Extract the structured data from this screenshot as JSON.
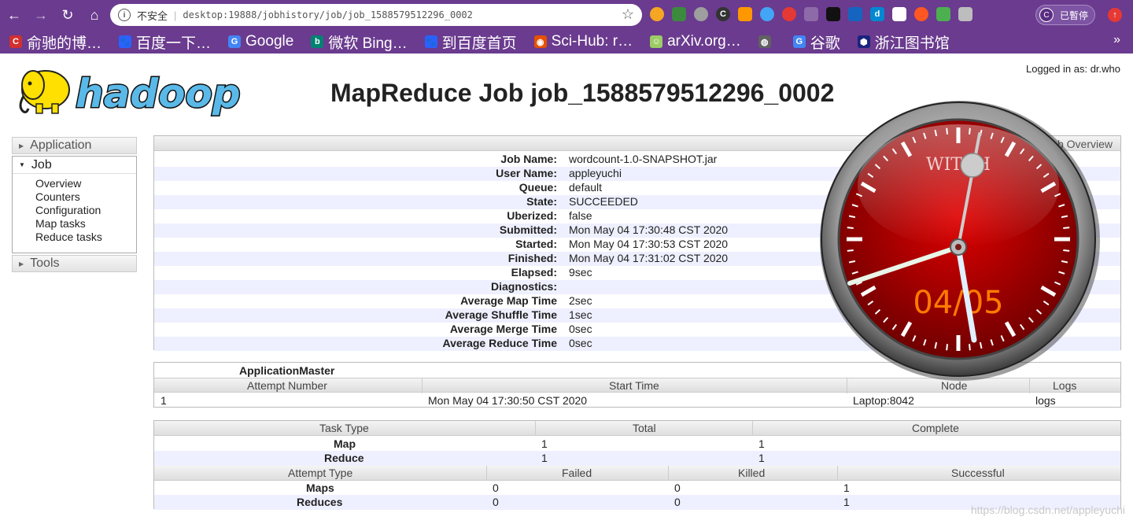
{
  "browser": {
    "insecure_label": "不安全",
    "url": "desktop:19888/jobhistory/job/job_1588579512296_0002",
    "profile_initial": "C",
    "profile_label": "已暫停",
    "bookmarks": [
      {
        "label": "俞驰的博…",
        "fav_color": "#d32f2f",
        "fav_char": "C"
      },
      {
        "label": "百度一下…",
        "fav_color": "#2962ff",
        "fav_char": "🐾"
      },
      {
        "label": "Google",
        "fav_color": "#4285f4",
        "fav_char": "G"
      },
      {
        "label": "微软 Bing…",
        "fav_color": "#008373",
        "fav_char": "b"
      },
      {
        "label": "到百度首页",
        "fav_color": "#2962ff",
        "fav_char": "🐾"
      },
      {
        "label": "Sci-Hub: r…",
        "fav_color": "#e65100",
        "fav_char": "◉"
      },
      {
        "label": "arXiv.org…",
        "fav_color": "#9ccc65",
        "fav_char": "☺"
      },
      {
        "label": "",
        "fav_color": "#616161",
        "fav_char": "◍"
      },
      {
        "label": "谷歌",
        "fav_color": "#4285f4",
        "fav_char": "G"
      },
      {
        "label": "浙江图书馆",
        "fav_color": "#1a237e",
        "fav_char": "⬢"
      }
    ],
    "bookmark_overflow": "»"
  },
  "header": {
    "logged_in": "Logged in as: dr.who",
    "title": "MapReduce Job job_1588579512296_0002"
  },
  "sidebar": {
    "application": "Application",
    "job": "Job",
    "job_items": [
      "Overview",
      "Counters",
      "Configuration",
      "Map tasks",
      "Reduce tasks"
    ],
    "tools": "Tools"
  },
  "overview": {
    "bar_label": "Job Overview",
    "rows": [
      {
        "k": "Job Name:",
        "v": "wordcount-1.0-SNAPSHOT.jar"
      },
      {
        "k": "User Name:",
        "v": "appleyuchi"
      },
      {
        "k": "Queue:",
        "v": "default"
      },
      {
        "k": "State:",
        "v": "SUCCEEDED"
      },
      {
        "k": "Uberized:",
        "v": "false"
      },
      {
        "k": "Submitted:",
        "v": "Mon May 04 17:30:48 CST 2020"
      },
      {
        "k": "Started:",
        "v": "Mon May 04 17:30:53 CST 2020"
      },
      {
        "k": "Finished:",
        "v": "Mon May 04 17:31:02 CST 2020"
      },
      {
        "k": "Elapsed:",
        "v": "9sec"
      },
      {
        "k": "Diagnostics:",
        "v": ""
      },
      {
        "k": "Average Map Time",
        "v": "2sec"
      },
      {
        "k": "Average Shuffle Time",
        "v": "1sec"
      },
      {
        "k": "Average Merge Time",
        "v": "0sec"
      },
      {
        "k": "Average Reduce Time",
        "v": "0sec"
      }
    ]
  },
  "application_master": {
    "title": "ApplicationMaster",
    "headers": [
      "Attempt Number",
      "Start Time",
      "Node",
      "Logs"
    ],
    "row": [
      "1",
      "Mon May 04 17:30:50 CST 2020",
      "Laptop:8042",
      "logs"
    ]
  },
  "tasks": {
    "headers": [
      "Task Type",
      "Total",
      "Complete"
    ],
    "rows": [
      {
        "type": "Map",
        "total": "1",
        "complete": "1"
      },
      {
        "type": "Reduce",
        "total": "1",
        "complete": "1"
      }
    ],
    "attempt_headers": [
      "Attempt Type",
      "Failed",
      "Killed",
      "Successful"
    ],
    "attempt_rows": [
      {
        "type": "Maps",
        "failed": "0",
        "killed": "0",
        "successful": "1"
      },
      {
        "type": "Reduces",
        "failed": "0",
        "killed": "0",
        "successful": "1"
      }
    ]
  },
  "clock": {
    "brand": "WITCH",
    "date": "04/05",
    "face_color": "#c40000",
    "date_color": "#ff7a00"
  },
  "watermark": "https://blog.csdn.net/appleyuchi"
}
